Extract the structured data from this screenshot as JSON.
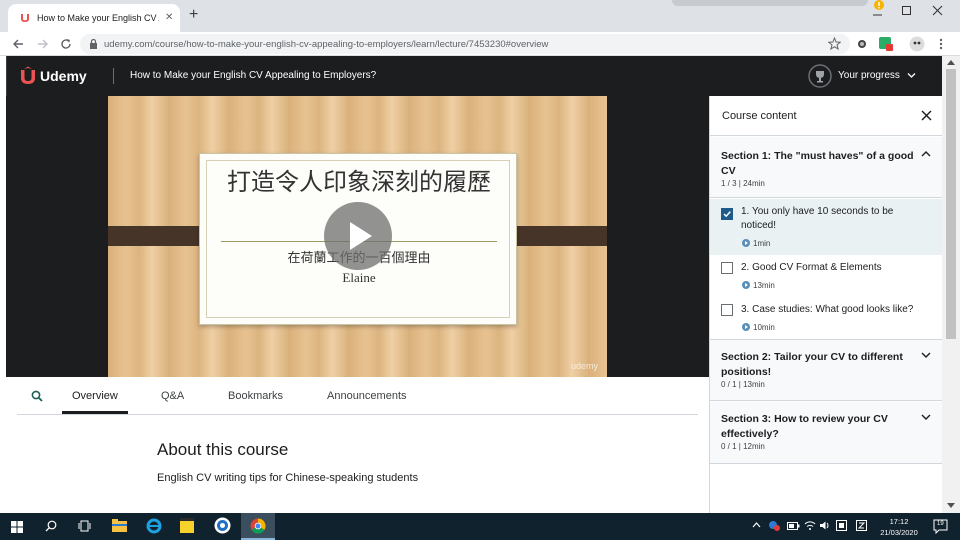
{
  "browser": {
    "tab_title": "How to Make your English CV Appealing to Employers",
    "url": "udemy.com/course/how-to-make-your-english-cv-appealing-to-employers/learn/lecture/7453230#overview",
    "new_tab_symbol": "+",
    "close_tab_symbol": "✕"
  },
  "header": {
    "logo": "Udemy",
    "course_title": "How to Make your English CV Appealing to Employers?",
    "progress_label": "Your progress"
  },
  "video": {
    "slide_title": "打造令人印象深刻的履歷",
    "slide_subtitle": "在荷蘭工作的一百個理由",
    "slide_author": "Elaine",
    "watermark": "udemy"
  },
  "tabs": [
    {
      "label": "Overview",
      "active": true
    },
    {
      "label": "Q&A",
      "active": false
    },
    {
      "label": "Bookmarks",
      "active": false
    },
    {
      "label": "Announcements",
      "active": false
    }
  ],
  "about": {
    "title": "About this course",
    "subtitle": "English CV writing tips for Chinese-speaking students"
  },
  "sidebar": {
    "title": "Course content",
    "sections": [
      {
        "title": "Section 1: The \"must haves\" of a good CV",
        "meta": "1 / 3 | 24min",
        "expanded": true,
        "lectures": [
          {
            "title": "1. You only have 10 seconds to be noticed!",
            "duration": "1min",
            "checked": true,
            "active": true
          },
          {
            "title": "2. Good CV Format & Elements",
            "duration": "13min",
            "checked": false,
            "active": false
          },
          {
            "title": "3. Case studies: What good looks like?",
            "duration": "10min",
            "checked": false,
            "active": false
          }
        ]
      },
      {
        "title": "Section 2: Tailor your CV to different positions!",
        "meta": "0 / 1 | 13min",
        "expanded": false
      },
      {
        "title": "Section 3: How to review your CV effectively?",
        "meta": "0 / 1 | 12min",
        "expanded": false
      }
    ]
  },
  "taskbar": {
    "time": "17:12",
    "date": "21/03/2020",
    "notification_count": "19"
  },
  "colors": {
    "udemy_header": "#1c1d1f",
    "udemy_red": "#ec5252",
    "taskbar": "#10222e",
    "active_lecture": "#e9f1f3"
  }
}
